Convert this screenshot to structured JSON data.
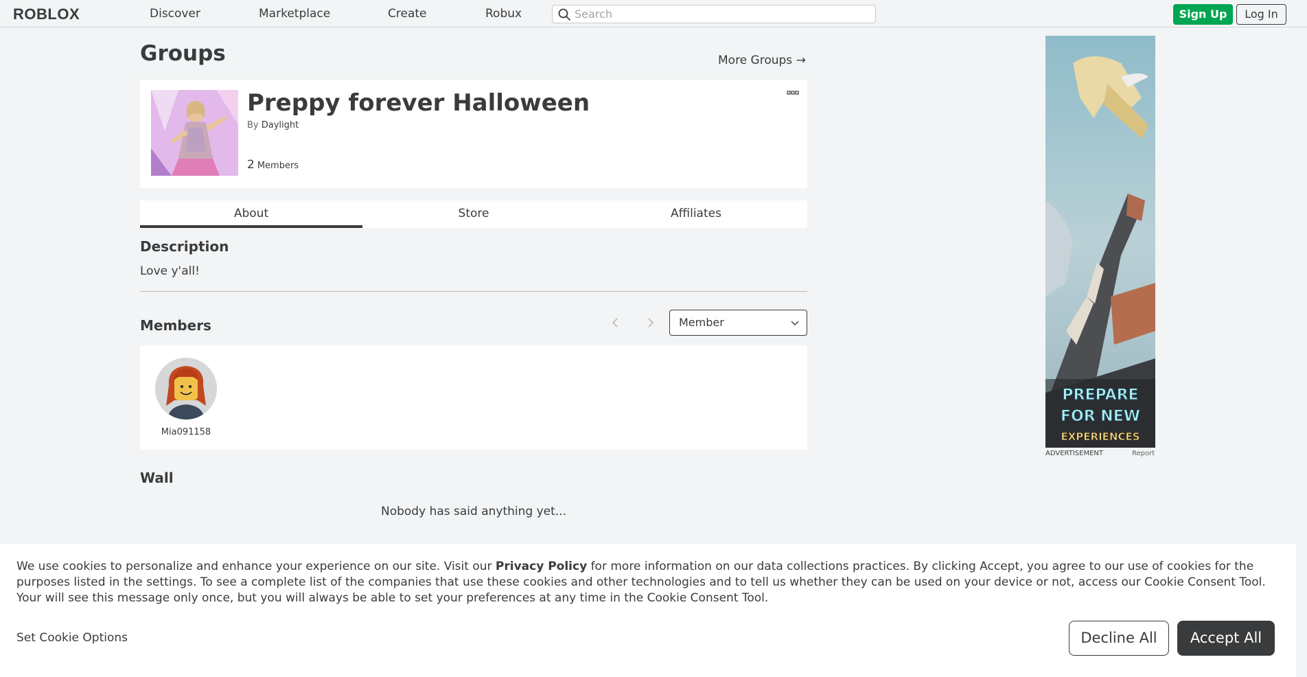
{
  "header": {
    "logo_text": "ROBLOX",
    "nav": [
      "Discover",
      "Marketplace",
      "Create",
      "Robux"
    ],
    "search_placeholder": "Search",
    "signup_label": "Sign Up",
    "login_label": "Log In"
  },
  "page": {
    "title": "Groups",
    "more_groups": "More Groups →"
  },
  "group": {
    "name": "Preppy forever Halloween",
    "by_prefix": "By",
    "owner": "Daylight",
    "member_count": "2",
    "members_label": "Members"
  },
  "tabs": [
    "About",
    "Store",
    "Affiliates"
  ],
  "about": {
    "description_heading": "Description",
    "description_text": "Love y'all!",
    "members_heading": "Members",
    "role_selected": "Member",
    "members": [
      {
        "name": "Mia091158"
      }
    ],
    "wall_heading": "Wall",
    "wall_empty": "Nobody has said anything yet..."
  },
  "ad": {
    "line1": "PREPARE",
    "line2": "FOR NEW",
    "line3": "EXPERIENCES",
    "label": "ADVERTISEMENT",
    "report": "Report"
  },
  "cookie": {
    "text_before": "We use cookies to personalize and enhance your experience on our site. Visit our ",
    "privacy_link": "Privacy Policy",
    "text_after": " for more information on our data collections practices. By clicking Accept, you agree to our use of cookies for the purposes listed in the settings. To see a complete list of the companies that use these cookies and other technologies and to tell us whether they can be used on your device or not, access our Cookie Consent Tool. Your will see this message only once, but you will always be able to set your preferences at any time in the Cookie Consent Tool.",
    "options_label": "Set Cookie Options",
    "decline_label": "Decline All",
    "accept_label": "Accept All"
  },
  "colors": {
    "accent_green": "#00a651",
    "text_dark": "#393b3d",
    "page_bg": "#f2f4f5"
  }
}
